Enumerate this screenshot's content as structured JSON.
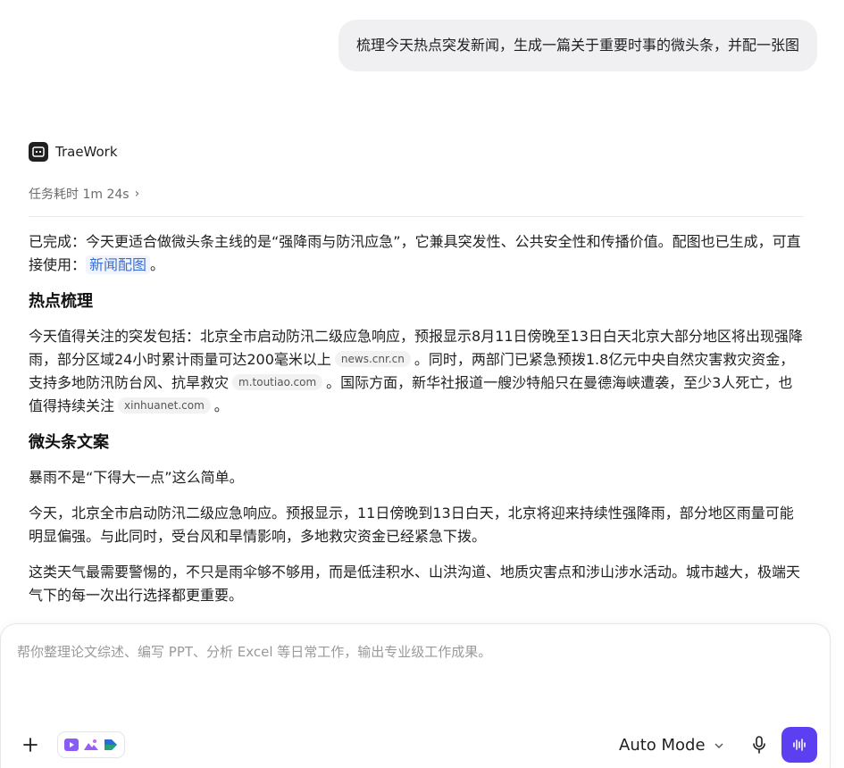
{
  "user_message": "梳理今天热点突发新闻，生成一篇关于重要时事的微头条，并配一张图",
  "agent": {
    "name": "TraeWork",
    "task_time": "任务耗时 1m 24s"
  },
  "response": {
    "intro": {
      "text": "已完成：今天更适合做微头条主线的是“强降雨与防汛应急”，它兼具突发性、公共安全性和传播价值。配图也已生成，可直接使用：",
      "link": "新闻配图",
      "end": "。"
    },
    "section1_title": "热点梳理",
    "section1": {
      "part1": "今天值得关注的突发包括：北京全市启动防汛二级应急响应，预报显示8月11日傍晚至13日白天北京大部分地区将出现强降雨，部分区域24小时累计雨量可达200毫米以上",
      "source1": "news.cnr.cn",
      "part2": "。同时，两部门已紧急预拨1.8亿元中央自然灾害救灾资金，支持多地防汛防台风、抗旱救灾",
      "source2": "m.toutiao.com",
      "part3": "。国际方面，新华社报道一艘沙特船只在曼德海峡遭袭，至少3人死亡，也值得持续关注",
      "source3": "xinhuanet.com",
      "part4": "。"
    },
    "section2_title": "微头条文案",
    "copy": [
      "暴雨不是“下得大一点”这么简单。",
      "今天，北京全市启动防汛二级应急响应。预报显示，11日傍晚到13日白天，北京将迎来持续性强降雨，部分地区雨量可能明显偏强。与此同时，受台风和旱情影响，多地救灾资金已经紧急下拨。",
      "这类天气最需要警惕的，不只是雨伞够不够用，而是低洼积水、山洪沟道、地质灾害点和涉山涉水活动。城市越大，极端天气下的每一次出行选择都更重要。"
    ]
  },
  "composer": {
    "placeholder": "帮你整理论文综述、编写 PPT、分析 Excel 等日常工作，输出专业级工作成果。",
    "mode": "Auto Mode"
  },
  "icons": {
    "agent_logo": "terminal-icon",
    "chevron": "chevron-right-icon",
    "plus": "plus-icon",
    "video": "video-icon",
    "image": "image-icon",
    "slides": "slides-icon",
    "mode_chevron": "chevron-down-icon",
    "mic": "microphone-icon",
    "send": "voice-wave-icon"
  },
  "colors": {
    "accent": "#5b3ff0",
    "link": "#3b6fd8",
    "bubble": "#f0f0f2"
  }
}
